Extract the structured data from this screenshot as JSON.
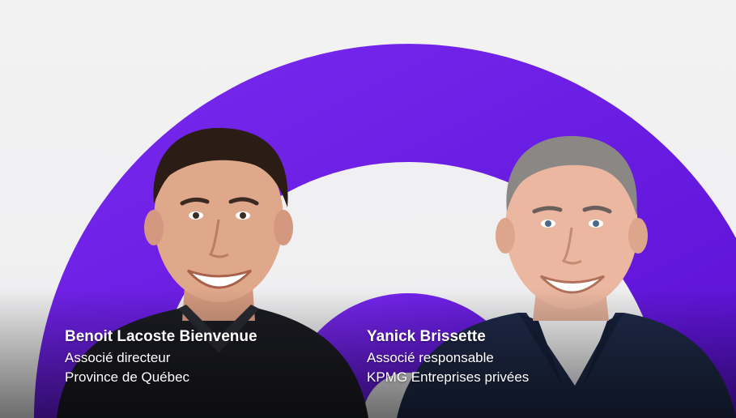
{
  "colors": {
    "background": "#f0f0f1",
    "ring": "#6d1ee6",
    "ring_dark": "#5a12d6",
    "caption_text": "#ffffff"
  },
  "people": [
    {
      "name": "Benoit Lacoste Bienvenue",
      "title": "Associé directeur",
      "subtitle": "Province de Québec"
    },
    {
      "name": "Yanick Brissette",
      "title": "Associé responsable",
      "subtitle": "KPMG Entreprises privées"
    }
  ]
}
